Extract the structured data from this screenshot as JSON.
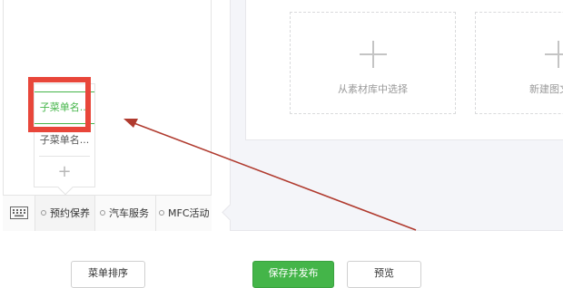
{
  "submenu": {
    "items": [
      {
        "label": "子菜单名..."
      },
      {
        "label": "子菜单名..."
      }
    ],
    "add_label": "+"
  },
  "menubar": {
    "items": [
      {
        "label": "预约保养"
      },
      {
        "label": "汽车服务"
      },
      {
        "label": "MFC活动"
      }
    ]
  },
  "content": {
    "cards": [
      {
        "label": "从素材库中选择"
      },
      {
        "label": "新建图文消"
      }
    ]
  },
  "footer": {
    "sort_label": "菜单排序",
    "save_label": "保存并发布",
    "preview_label": "预览"
  },
  "colors": {
    "accent": "#44b549",
    "highlight": "#e8463a",
    "arrow": "#b03a2e"
  }
}
